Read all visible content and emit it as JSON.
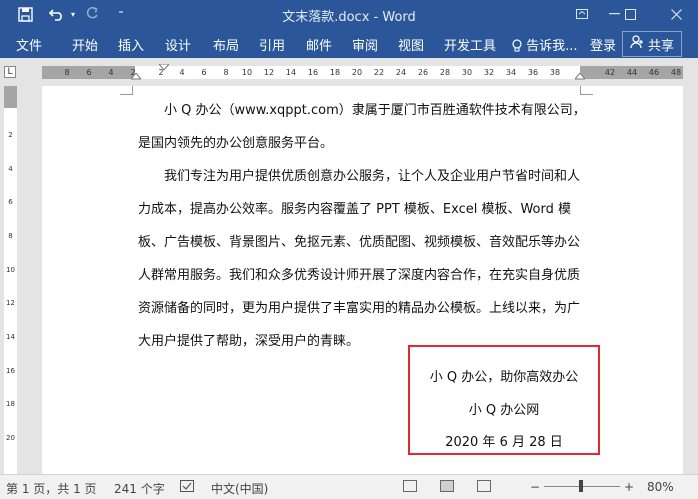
{
  "window": {
    "title": "文末落款.docx - Word",
    "quick_access": {
      "save_icon": "save-icon",
      "undo_icon": "undo-icon",
      "redo_icon": "redo-icon",
      "customize_icon": "customize-icon"
    }
  },
  "ribbon": {
    "tabs": [
      "文件",
      "开始",
      "插入",
      "设计",
      "布局",
      "引用",
      "邮件",
      "审阅",
      "视图",
      "开发工具"
    ],
    "tell_me": "告诉我...",
    "sign_in": "登录",
    "share": "共享"
  },
  "ruler": {
    "corner": "L",
    "left_ticks": [
      "8",
      "6",
      "4",
      "2"
    ],
    "main_ticks": [
      "2",
      "4",
      "6",
      "8",
      "10",
      "12",
      "14",
      "16",
      "18",
      "20",
      "22",
      "24",
      "26",
      "28",
      "30",
      "32",
      "34",
      "36",
      "38"
    ],
    "right_ticks": [
      "42",
      "44",
      "46",
      "48"
    ],
    "vertical_ticks": [
      "2",
      "4",
      "6",
      "8",
      "10",
      "12",
      "14",
      "16",
      "18",
      "20"
    ]
  },
  "document": {
    "paragraph1": [
      "小 Q 办公（www.xqppt.com）隶属于厦门市百胜通软件技术有限公司，",
      "是国内领先的办公创意服务平台。"
    ],
    "paragraph2": [
      "我们专注为用户提供优质创意办公服务，让个人及企业用户节省时间和人",
      "力成本，提高办公效率。服务内容覆盖了 PPT 模板、Excel 模板、Word 模",
      "板、广告模板、背景图片、免抠元素、优质配图、视频模板、音效配乐等办公",
      "人群常用服务。我们和众多优秀设计师开展了深度内容合作，在充实自身优质",
      "资源储备的同时，更为用户提供了丰富实用的精品办公模板。上线以来，为广",
      "大用户提供了帮助，深受用户的青睐。"
    ],
    "signature": {
      "line1": "小 Q 办公，助你高效办公",
      "line2": "小 Q 办公网",
      "line3": "2020 年 6 月 28 日"
    }
  },
  "status_bar": {
    "page": "第 1 页，共 1 页",
    "word_count": "241 个字",
    "language": "中文(中国)",
    "zoom": "80%",
    "zoom_minus": "−",
    "zoom_plus": "+"
  },
  "colors": {
    "ribbon": "#2b579a",
    "highlight_box": "#e0282e"
  }
}
